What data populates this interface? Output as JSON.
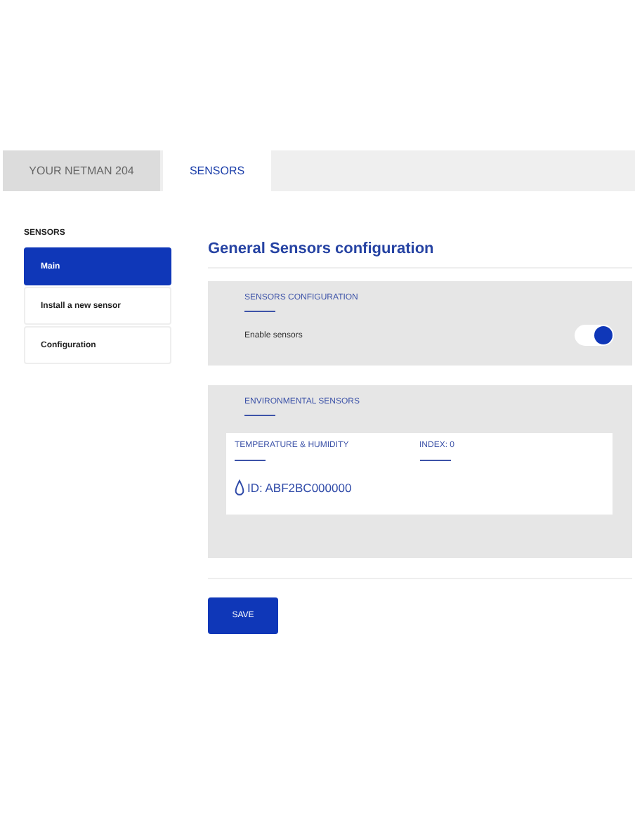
{
  "tabs": [
    {
      "label": "YOUR NETMAN 204",
      "selected": false
    },
    {
      "label": "SENSORS",
      "selected": true
    }
  ],
  "sidebar": {
    "title": "SENSORS",
    "items": [
      {
        "label": "Main",
        "selected": true
      },
      {
        "label": "Install a new sensor",
        "selected": false
      },
      {
        "label": "Configuration",
        "selected": false
      }
    ]
  },
  "content": {
    "title": "General Sensors configuration",
    "sensors_configuration": {
      "title": "SENSORS CONFIGURATION",
      "toggle": {
        "label": "Enable sensors",
        "on": true
      }
    },
    "environmental_sensors": {
      "title": "ENVIRONMENTAL SENSORS",
      "cards": [
        {
          "type": "TEMPERATURE & HUMIDITY",
          "index": "INDEX: 0",
          "id": "ID: ABF2BC000000"
        }
      ]
    },
    "save_button": "SAVE"
  }
}
